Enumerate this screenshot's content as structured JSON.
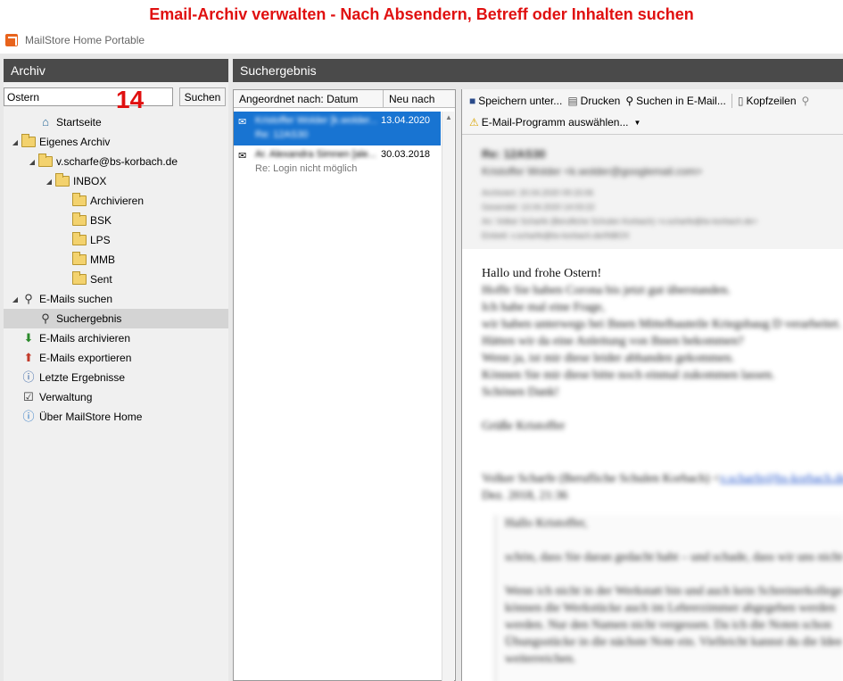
{
  "banner": "Email-Archiv verwalten - Nach Absendern, Betreff oder Inhalten suchen",
  "app_title": "MailStore Home Portable",
  "annotation_number": "14",
  "left_panel": {
    "title": "Archiv",
    "search_value": "Ostern",
    "search_button": "Suchen",
    "tree": [
      {
        "label": "Startseite",
        "level": 1,
        "icon": "home-icon",
        "toggle": ""
      },
      {
        "label": "Eigenes Archiv",
        "level": 0,
        "icon": "folder-icon",
        "toggle": "◢"
      },
      {
        "label": "v.scharfe@bs-korbach.de",
        "level": 1,
        "icon": "folder-icon",
        "toggle": "◢"
      },
      {
        "label": "INBOX",
        "level": 2,
        "icon": "folder-icon",
        "toggle": "◢"
      },
      {
        "label": "Archivieren",
        "level": 3,
        "icon": "folder-icon",
        "toggle": ""
      },
      {
        "label": "BSK",
        "level": 3,
        "icon": "folder-icon",
        "toggle": ""
      },
      {
        "label": "LPS",
        "level": 3,
        "icon": "folder-icon",
        "toggle": ""
      },
      {
        "label": "MMB",
        "level": 3,
        "icon": "folder-icon",
        "toggle": ""
      },
      {
        "label": "Sent",
        "level": 3,
        "icon": "folder-icon",
        "toggle": ""
      },
      {
        "label": "E-Mails suchen",
        "level": 0,
        "icon": "magnifier-icon",
        "toggle": "◢"
      },
      {
        "label": "Suchergebnis",
        "level": 1,
        "icon": "magnifier-icon",
        "toggle": "",
        "selected": true
      },
      {
        "label": "E-Mails archivieren",
        "level": 0,
        "icon": "archive-download-icon",
        "toggle": ""
      },
      {
        "label": "E-Mails exportieren",
        "level": 0,
        "icon": "export-icon",
        "toggle": ""
      },
      {
        "label": "Letzte Ergebnisse",
        "level": 0,
        "icon": "info-list-icon",
        "toggle": ""
      },
      {
        "label": "Verwaltung",
        "level": 0,
        "icon": "checklist-icon",
        "toggle": ""
      },
      {
        "label": "Über MailStore Home",
        "level": 0,
        "icon": "info-icon",
        "toggle": ""
      }
    ]
  },
  "middle_panel": {
    "title": "Suchergebnis",
    "sort_label": "Angeordnet nach: Datum",
    "order_label": "Neu nach alt",
    "rows": [
      {
        "from": "Kristoffer Wolder [k.wolder...",
        "date": "13.04.2020",
        "subject": "Re: 12AS30",
        "selected": true,
        "subject_blurred": true
      },
      {
        "from": "Ar. Alexandra Simnen [ale...",
        "date": "30.03.2018",
        "subject": "Re: Login nicht möglich",
        "selected": false,
        "subject_blurred": false
      }
    ]
  },
  "toolbar": {
    "save": "Speichern unter...",
    "print": "Drucken",
    "search_in_email": "Suchen in E-Mail...",
    "headers": "Kopfzeilen",
    "choose_client": "E-Mail-Programm auswählen..."
  },
  "message": {
    "subject": "Re: 12AS30",
    "from": "Kristoffer Wolder <k.wolder@googlemail.com>",
    "meta": [
      "Archiviert:   20.04.2020 09:15:06",
      "Gesendet:    13.04.2020 14:03:22",
      "An:              Volker Scharfe (Berufliche Schulen Korbach) <v.scharfe@bs-korbach.de>",
      "Einbett:       v.scharfe@bs-korbach.de/INBOX"
    ],
    "greeting": "Hallo und frohe Ostern!",
    "body_lines": [
      "Hoffe Sie haben Corona bis jetzt gut überstanden.",
      "Ich habe mal eine Frage,",
      "wir haben unterwegs bei Ihnen Mittelbauteile Kriegsbaug D verarbeitet.",
      "Hätten wir da eine Anleitung von Ihnen bekommen?",
      "Wenn ja, ist mir diese leider abhanden gekommen.",
      "Können Sie mir diese bitte noch einmal zukommen lassen.",
      "Schönen Dank!",
      "",
      "Grüße Kristoffer"
    ],
    "reply_header": "Volker Scharfe (Berufliche Schulen Korbach) <",
    "reply_link": "v.scharfe@bs-korbach.de",
    "reply_date": "Dez. 2018, 21:36",
    "quote_lines": [
      "Hallo Kristoffer,",
      "",
      "schön, dass Sie daran gedacht habt – und schade, dass wir uns nicht mehr sehen.",
      "",
      "Wenn ich nicht in der Werkstatt bin und auch kein Schreinerkollege da ist,",
      "können die Werkstücke auch im Lehrerzimmer abgegeben werden",
      "werden. Nur den Namen nicht vergessen. Da ich die Noten schon",
      "Übungsstücke in die nächste Note ein. Vielleicht kannst du die Idee",
      "weiterreichen."
    ]
  }
}
